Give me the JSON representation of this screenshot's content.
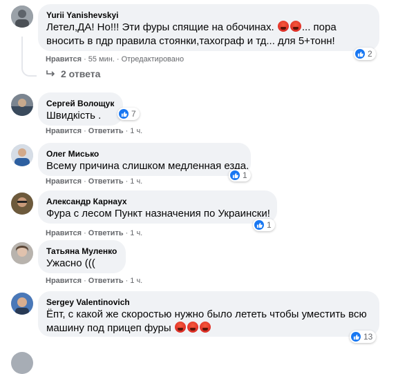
{
  "comments": [
    {
      "author": "Yurii Yanishevskyi",
      "line1": "Летел,ДА! Но!!! Эти фуры спящие на обочинах.",
      "line1_after": "... пора",
      "line2": "вносить в пдр правила стоянки,тахограф и тд... для 5+тонн!",
      "like": "Нравится",
      "time": "55 мин.",
      "edited": "Отредактировано",
      "reactions": "2",
      "replies": "2 ответа"
    },
    {
      "author": "Сергей Волощук",
      "text": "Швидкість .",
      "like": "Нравится",
      "reply": "Ответить",
      "time": "1 ч.",
      "reactions": "7"
    },
    {
      "author": "Олег Мисько",
      "text": "Всему причина слишком медленная езда.",
      "like": "Нравится",
      "reply": "Ответить",
      "time": "1 ч.",
      "reactions": "1"
    },
    {
      "author": "Александр Карнаух",
      "text": "Фура с лесом Пункт назначения по Украински!",
      "like": "Нравится",
      "reply": "Ответить",
      "time": "1 ч.",
      "reactions": "1"
    },
    {
      "author": "Татьяна Муленко",
      "text": "Ужасно (((",
      "like": "Нравится",
      "reply": "Ответить",
      "time": "1 ч."
    },
    {
      "author": "Sergey Valentinovich",
      "line1": "Ёпт, с какой же скоростью нужно было лететь чтобы уместить всю",
      "line2": "машину под прицеп фуры",
      "reactions": "13"
    }
  ],
  "colors": {
    "bubble": "#f0f2f5",
    "meta": "#65676b",
    "like_blue": "#1877f2"
  }
}
